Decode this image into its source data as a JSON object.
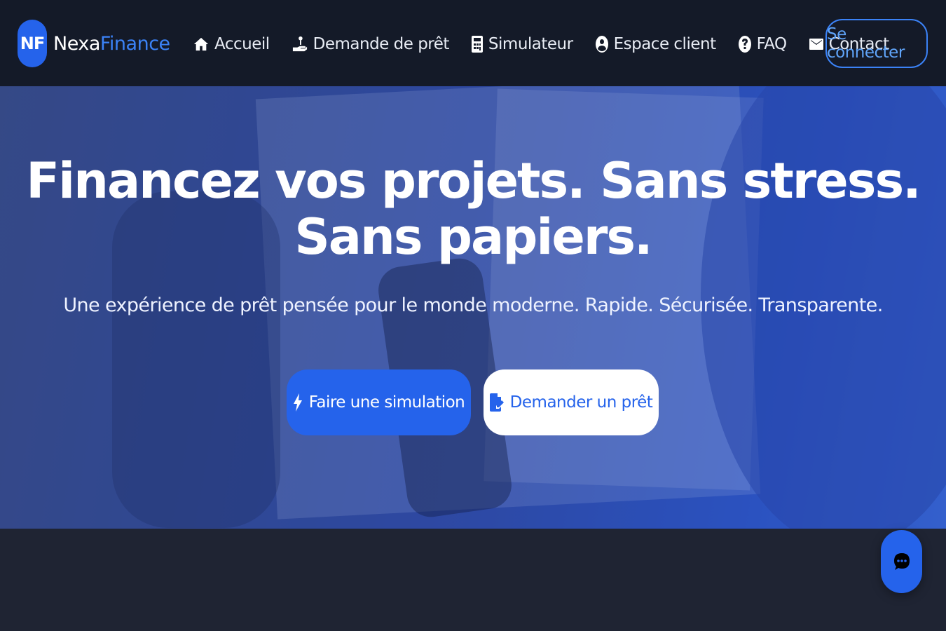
{
  "brand": {
    "badge": "NF",
    "name_part1": "Nexa",
    "name_part2": "Finance"
  },
  "nav": {
    "items": [
      {
        "label": "Accueil",
        "icon": "home-icon"
      },
      {
        "label": "Demande de prêt",
        "icon": "hand-coin-icon"
      },
      {
        "label": "Simulateur",
        "icon": "calculator-icon"
      },
      {
        "label": "Espace client",
        "icon": "user-circle-icon"
      },
      {
        "label": "FAQ",
        "icon": "question-circle-icon"
      },
      {
        "label": "Contact",
        "icon": "envelope-icon"
      }
    ],
    "login_label": "Se connecter"
  },
  "hero": {
    "title_line1": "Financez vos projets. Sans stress.",
    "title_line2": "Sans papiers.",
    "subtitle": "Une expérience de prêt pensée pour le monde moderne. Rapide. Sécurisée. Transparente.",
    "primary_cta": "Faire une simulation",
    "primary_icon": "bolt-icon",
    "secondary_cta": "Demander un prêt",
    "secondary_icon": "file-signature-icon"
  },
  "chat": {
    "icon": "chat-bubble-icon"
  },
  "colors": {
    "accent": "#2563eb",
    "nav_bg": "#141a28",
    "page_bg": "#1e2433"
  }
}
